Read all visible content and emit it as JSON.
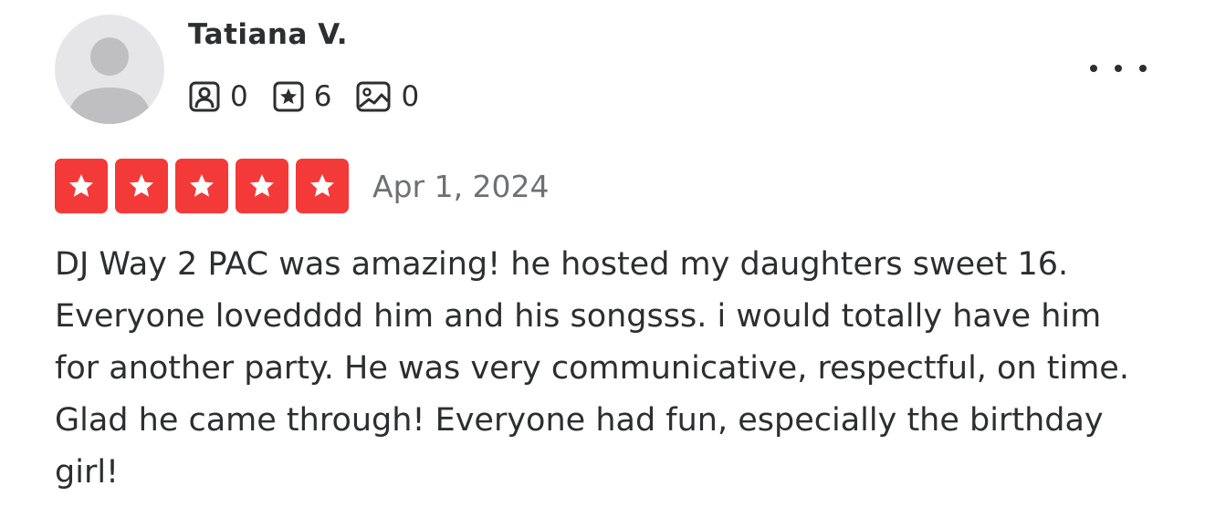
{
  "user": {
    "name": "Tatiana V.",
    "avatar_icon": "default-user-avatar-icon",
    "stats": {
      "friends": {
        "icon": "friends-icon",
        "value": "0"
      },
      "reviews": {
        "icon": "review-star-icon",
        "value": "6"
      },
      "photos": {
        "icon": "photo-icon",
        "value": "0"
      }
    }
  },
  "menu": {
    "icon": "more-options-icon"
  },
  "review": {
    "rating": 5,
    "rating_max": 5,
    "rating_color": "#f43939",
    "date": "Apr 1, 2024",
    "text": "DJ Way 2 PAC was amazing! he hosted my daughters sweet 16. Everyone lovedddd him and his songsss. i would totally have him for another party. He was very communicative, respectful, on time. Glad he came through! Everyone had fun, especially the birthday girl!"
  }
}
